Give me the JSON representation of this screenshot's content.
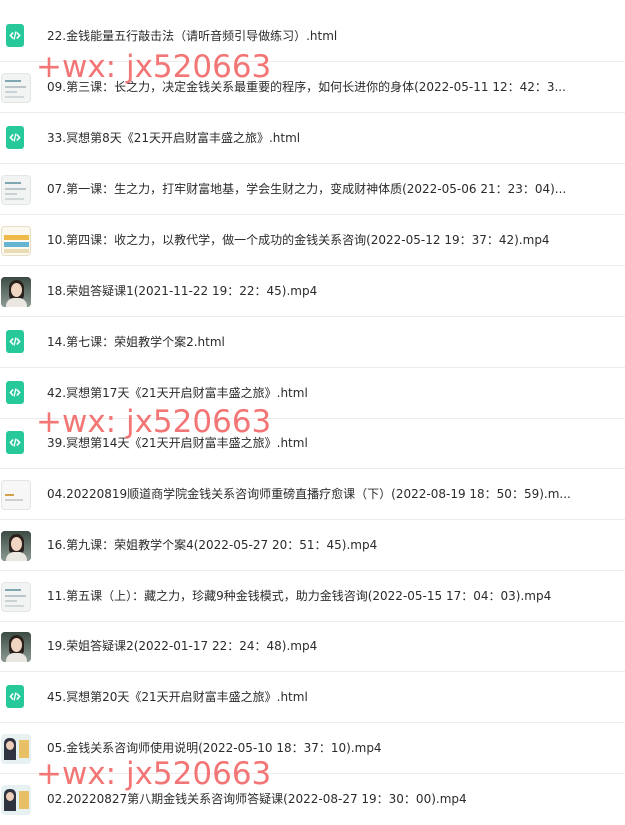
{
  "files": [
    {
      "name": "22.金钱能量五行敲击法（请听音频引导做练习）.html",
      "thumb": "html-icon"
    },
    {
      "name": "09.第三课：长之力，决定金钱关系最重要的程序，如何长进你的身体(2022-05-11 12：42：3...",
      "thumb": "thumb-slide"
    },
    {
      "name": "33.冥想第8天《21天开启财富丰盛之旅》.html",
      "thumb": "html-icon"
    },
    {
      "name": "07.第一课：生之力，打牢财富地基，学会生财之力，变成财神体质(2022-05-06 21：23：04)...",
      "thumb": "thumb-slide"
    },
    {
      "name": "10.第四课：收之力，以教代学，做一个成功的金钱关系咨询(2022-05-12 19：37：42).mp4",
      "thumb": "thumb-table"
    },
    {
      "name": "18.荣姐答疑课1(2021-11-22 19：22：45).mp4",
      "thumb": "thumb-face"
    },
    {
      "name": "14.第七课：荣姐教学个案2.html",
      "thumb": "html-icon"
    },
    {
      "name": "42.冥想第17天《21天开启财富丰盛之旅》.html",
      "thumb": "html-icon"
    },
    {
      "name": "39.冥想第14天《21天开启财富丰盛之旅》.html",
      "thumb": "html-icon"
    },
    {
      "name": "04.20220819顺道商学院金钱关系咨询师重磅直播疗愈课（下）(2022-08-19 18：50：59).m...",
      "thumb": "thumb-white"
    },
    {
      "name": "16.第九课：荣姐教学个案4(2022-05-27 20：51：45).mp4",
      "thumb": "thumb-face"
    },
    {
      "name": "11.第五课（上）：藏之力，珍藏9种金钱模式，助力金钱咨询(2022-05-15 17：04：03).mp4",
      "thumb": "thumb-slide"
    },
    {
      "name": "19.荣姐答疑课2(2022-01-17 22：24：48).mp4",
      "thumb": "thumb-face"
    },
    {
      "name": "45.冥想第20天《21天开启财富丰盛之旅》.html",
      "thumb": "html-icon"
    },
    {
      "name": "05.金钱关系咨询师使用说明(2022-05-10 18：37：10).mp4",
      "thumb": "thumb-poster"
    },
    {
      "name": "02.20220827第八期金钱关系咨询师答疑课(2022-08-27 19：30：00).mp4",
      "thumb": "thumb-poster"
    }
  ],
  "watermark": "+wx: jx520663",
  "colors": {
    "html_icon": "#27c99b",
    "watermark": "#f36b6b",
    "divider": "#ececec",
    "text": "#2b2b2b"
  }
}
